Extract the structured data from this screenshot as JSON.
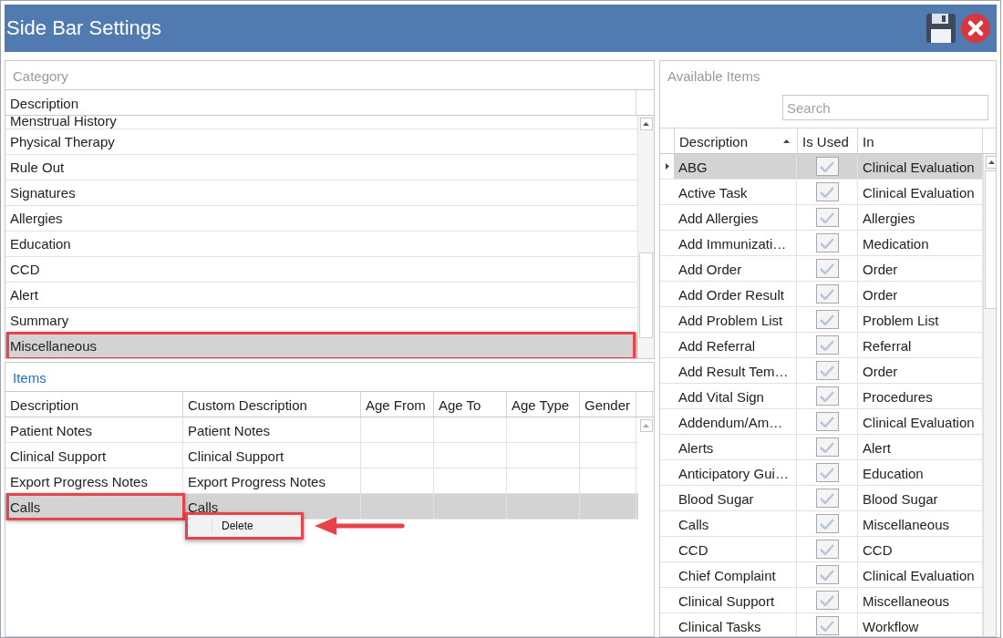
{
  "window": {
    "title": "Side Bar Settings"
  },
  "category": {
    "title": "Category",
    "column": "Description",
    "items": [
      {
        "label": "Menstrual History",
        "selected": false,
        "highlighted": false
      },
      {
        "label": "Physical Therapy",
        "selected": false,
        "highlighted": false
      },
      {
        "label": "Rule Out",
        "selected": false,
        "highlighted": false
      },
      {
        "label": "Signatures",
        "selected": false,
        "highlighted": false
      },
      {
        "label": "Allergies",
        "selected": false,
        "highlighted": false
      },
      {
        "label": "Education",
        "selected": false,
        "highlighted": false
      },
      {
        "label": "CCD",
        "selected": false,
        "highlighted": false
      },
      {
        "label": "Alert",
        "selected": false,
        "highlighted": false
      },
      {
        "label": "Summary",
        "selected": false,
        "highlighted": false
      },
      {
        "label": "Miscellaneous",
        "selected": true,
        "highlighted": true
      }
    ]
  },
  "items": {
    "title": "Items",
    "columns": [
      "Description",
      "Custom Description",
      "Age From",
      "Age To",
      "Age Type",
      "Gender"
    ],
    "rows": [
      {
        "description": "Patient Notes",
        "custom_description": "Patient Notes",
        "selected": false,
        "highlighted": false
      },
      {
        "description": "Clinical Support",
        "custom_description": "Clinical Support",
        "selected": false,
        "highlighted": false
      },
      {
        "description": "Export Progress Notes",
        "custom_description": "Export Progress Notes",
        "selected": false,
        "highlighted": false
      },
      {
        "description": "Calls",
        "custom_description": "Calls",
        "selected": true,
        "highlighted": true
      }
    ],
    "context_menu": {
      "items": [
        "Delete"
      ],
      "highlighted": true
    }
  },
  "available": {
    "title": "Available Items",
    "search": {
      "placeholder": "Search"
    },
    "columns": [
      "Description",
      "Is Used",
      "In"
    ],
    "rows": [
      {
        "description": "ABG",
        "is_used": true,
        "in": "Clinical Evaluation",
        "selected": true
      },
      {
        "description": "Active Task",
        "is_used": true,
        "in": "Clinical Evaluation",
        "selected": false
      },
      {
        "description": "Add Allergies",
        "is_used": true,
        "in": "Allergies",
        "selected": false
      },
      {
        "description": "Add Immunizati…",
        "is_used": true,
        "in": "Medication",
        "selected": false
      },
      {
        "description": "Add Order",
        "is_used": true,
        "in": "Order",
        "selected": false
      },
      {
        "description": "Add Order Result",
        "is_used": true,
        "in": "Order",
        "selected": false
      },
      {
        "description": "Add Problem List",
        "is_used": true,
        "in": "Problem List",
        "selected": false
      },
      {
        "description": "Add Referral",
        "is_used": true,
        "in": "Referral",
        "selected": false
      },
      {
        "description": "Add Result Tem…",
        "is_used": true,
        "in": "Order",
        "selected": false
      },
      {
        "description": "Add Vital Sign",
        "is_used": true,
        "in": "Procedures",
        "selected": false
      },
      {
        "description": "Addendum/Am…",
        "is_used": true,
        "in": "Clinical Evaluation",
        "selected": false
      },
      {
        "description": "Alerts",
        "is_used": true,
        "in": "Alert",
        "selected": false
      },
      {
        "description": "Anticipatory Gui…",
        "is_used": true,
        "in": "Education",
        "selected": false
      },
      {
        "description": "Blood Sugar",
        "is_used": true,
        "in": "Blood Sugar",
        "selected": false
      },
      {
        "description": "Calls",
        "is_used": true,
        "in": "Miscellaneous",
        "selected": false
      },
      {
        "description": "CCD",
        "is_used": true,
        "in": "CCD",
        "selected": false
      },
      {
        "description": "Chief Complaint",
        "is_used": true,
        "in": "Clinical Evaluation",
        "selected": false
      },
      {
        "description": "Clinical Support",
        "is_used": true,
        "in": "Miscellaneous",
        "selected": false
      },
      {
        "description": "Clinical Tasks",
        "is_used": true,
        "in": "Workflow",
        "selected": false
      }
    ]
  }
}
